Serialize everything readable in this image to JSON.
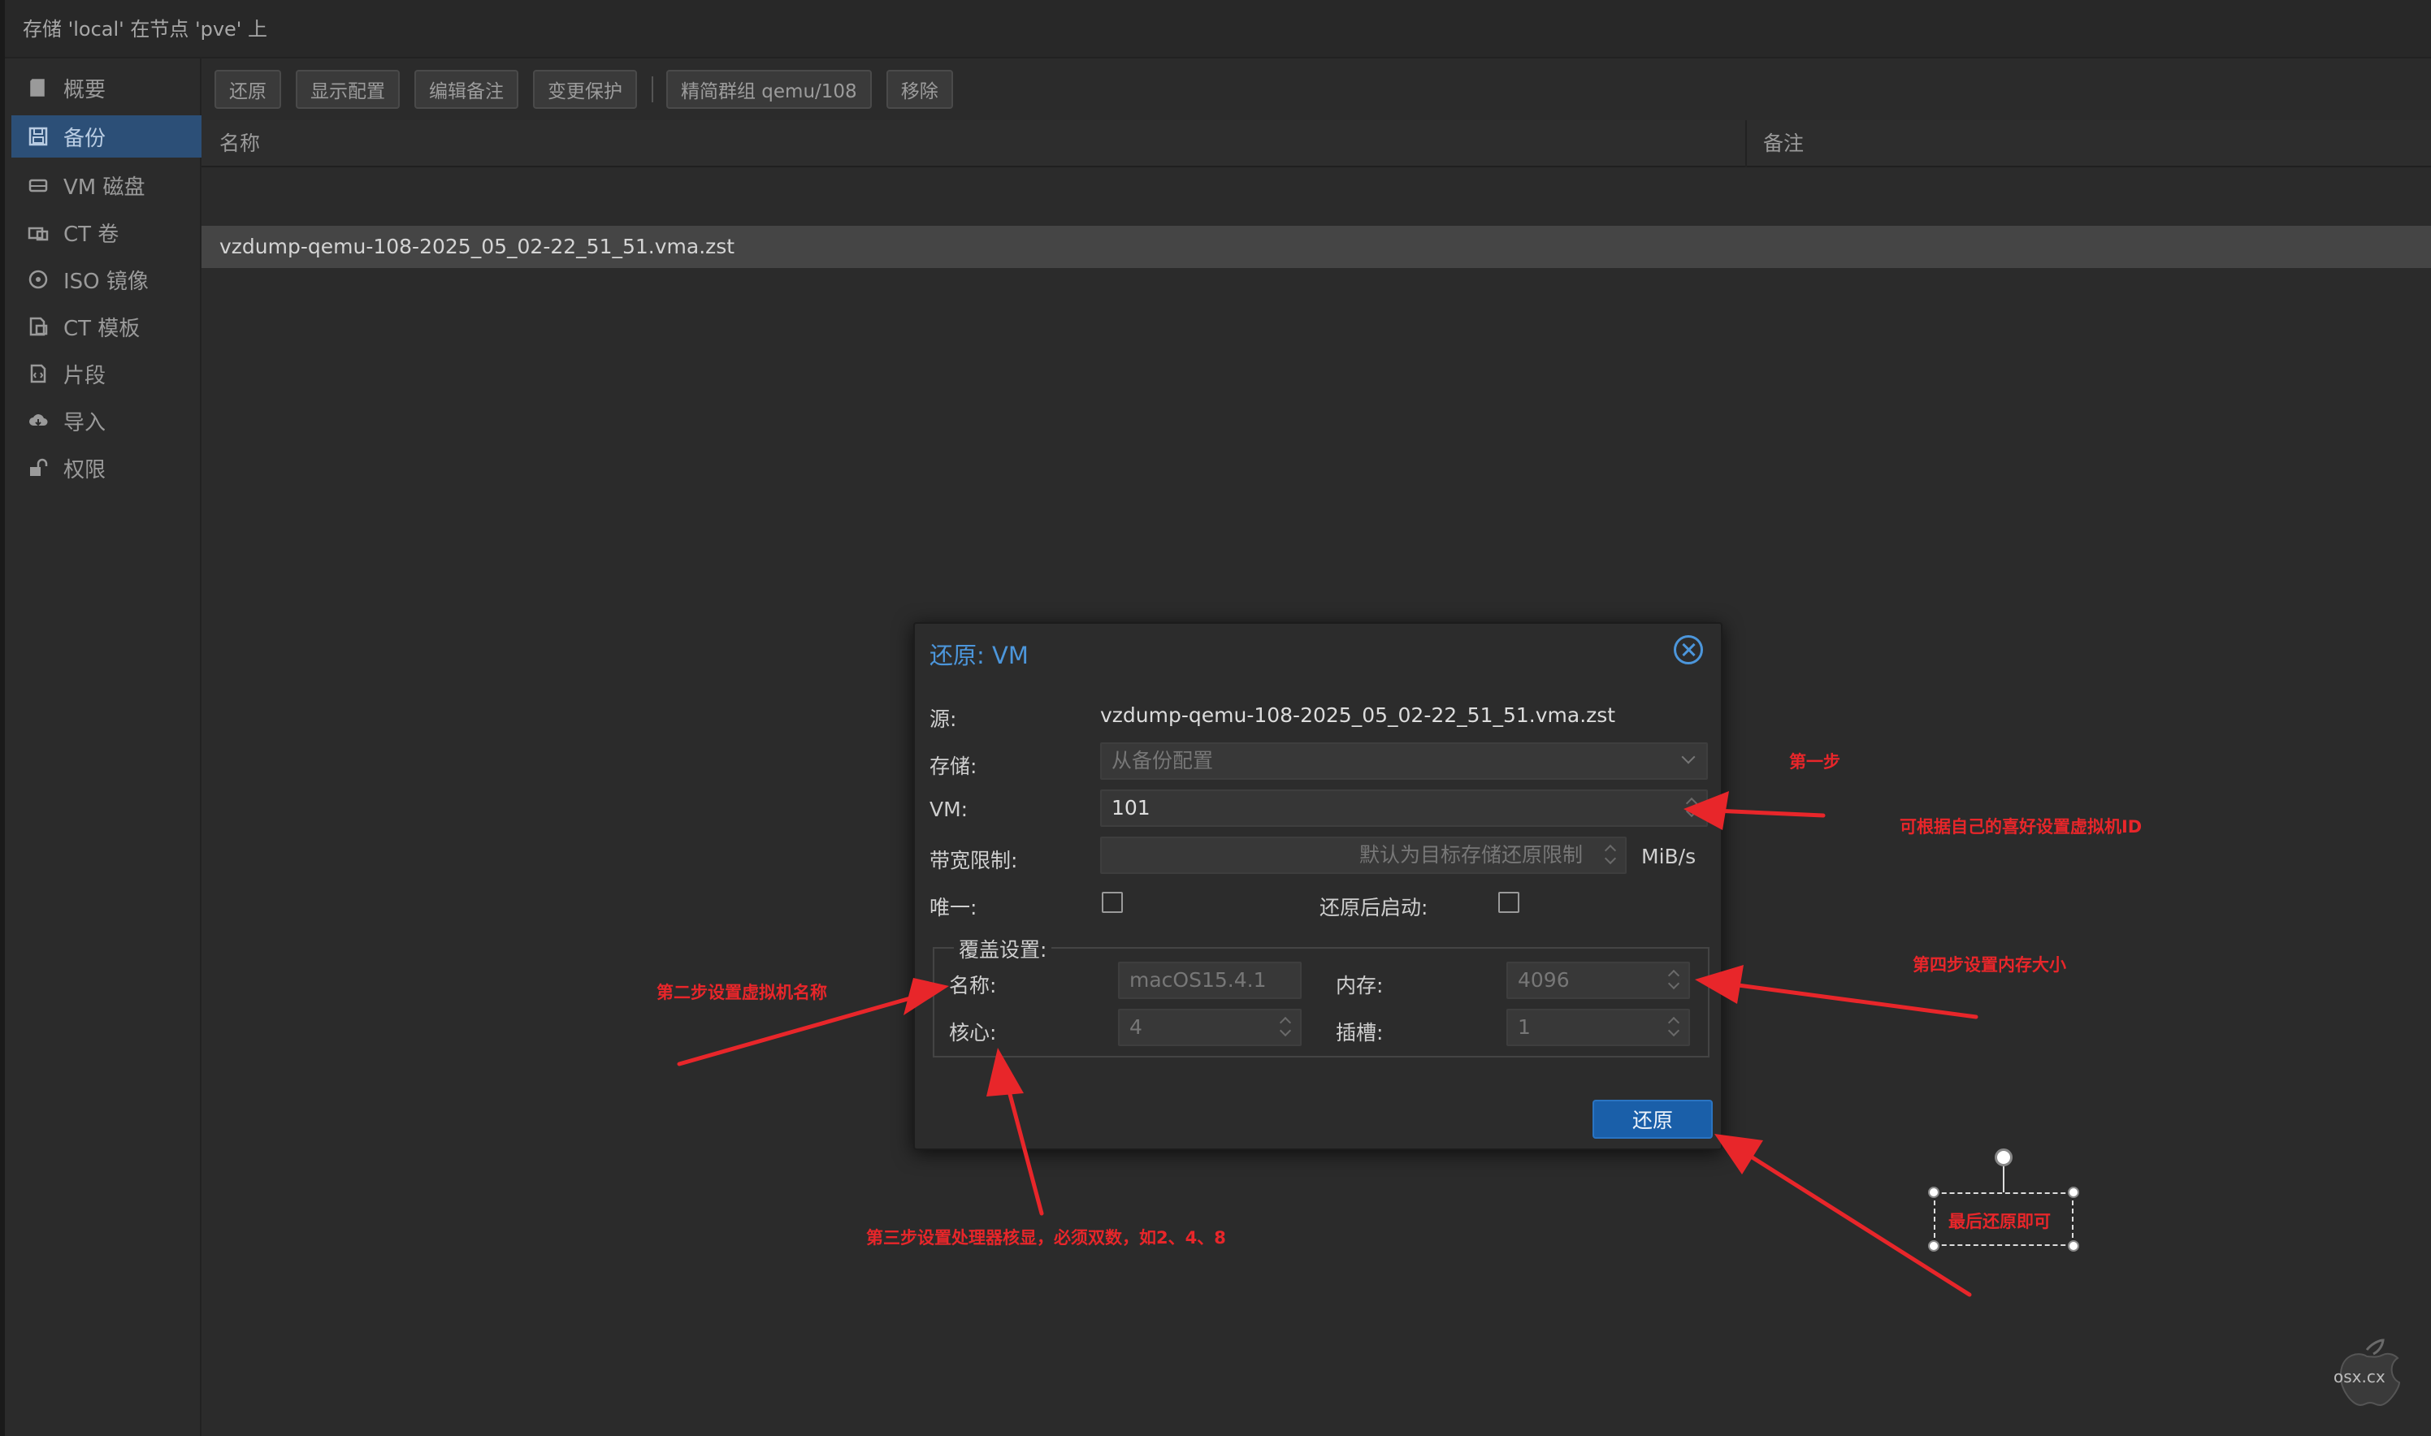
{
  "window": {
    "title": "存储 'local' 在节点 'pve' 上"
  },
  "sidebar": {
    "items": [
      {
        "label": "概要",
        "icon": "book-icon",
        "active": false
      },
      {
        "label": "备份",
        "icon": "floppy-icon",
        "active": true
      },
      {
        "label": "VM 磁盘",
        "icon": "hdd-icon",
        "active": false
      },
      {
        "label": "CT 卷",
        "icon": "ct-volume-icon",
        "active": false
      },
      {
        "label": "ISO 镜像",
        "icon": "disc-icon",
        "active": false
      },
      {
        "label": "CT 模板",
        "icon": "template-icon",
        "active": false
      },
      {
        "label": "片段",
        "icon": "snippet-icon",
        "active": false
      },
      {
        "label": "导入",
        "icon": "cloud-download-icon",
        "active": false
      },
      {
        "label": "权限",
        "icon": "unlock-icon",
        "active": false
      }
    ]
  },
  "toolbar": {
    "restore": "还原",
    "show_config": "显示配置",
    "edit_notes": "编辑备注",
    "change_protection": "变更保护",
    "prune_group": "精简群组 qemu/108",
    "remove": "移除"
  },
  "grid": {
    "columns": {
      "name": "名称",
      "notes": "备注"
    },
    "rows": [
      {
        "name": "vzdump-qemu-108-2025_05_02-22_51_51.vma.zst",
        "notes": ""
      }
    ]
  },
  "dialog": {
    "title": "还原: VM",
    "source_label": "源:",
    "source_value": "vzdump-qemu-108-2025_05_02-22_51_51.vma.zst",
    "storage_label": "存储:",
    "storage_value": "从备份配置",
    "vm_label": "VM:",
    "vm_value": "101",
    "bwlimit_label": "带宽限制:",
    "bwlimit_placeholder": "默认为目标存储还原限制",
    "bwlimit_unit": "MiB/s",
    "unique_label": "唯一:",
    "unique_checked": false,
    "start_after_label": "还原后启动:",
    "start_after_checked": false,
    "override_legend": "覆盖设置:",
    "name_label": "名称:",
    "name_value": "macOS15.4.1",
    "memory_label": "内存:",
    "memory_value": "4096",
    "cores_label": "核心:",
    "cores_value": "4",
    "sockets_label": "插槽:",
    "sockets_value": "1",
    "restore_button": "还原"
  },
  "annotations": {
    "step1": "第一步",
    "step1_detail": "可根据自己的喜好设置虚拟机ID",
    "step2": "第二步设置虚拟机名称",
    "step3": "第三步设置处理器核显，必须双数，如2、4、8",
    "step4": "第四步设置内存大小",
    "final": "最后还原即可",
    "color": "#e8262a"
  },
  "watermark": {
    "text": "osx.cx"
  }
}
